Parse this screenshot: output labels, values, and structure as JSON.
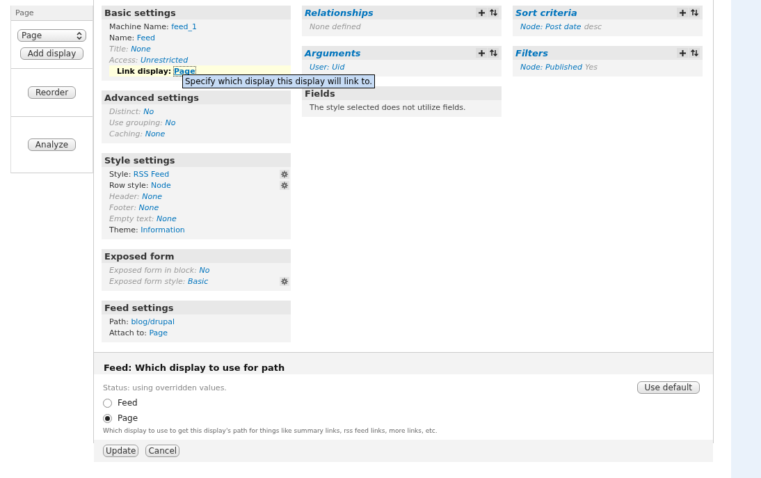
{
  "sidebar": {
    "tab_label": "Page",
    "select_value": "Page",
    "buttons": [
      "Add display",
      "Reorder",
      "Analyze"
    ]
  },
  "settings_sections": [
    {
      "title": "Basic settings",
      "items": [
        {
          "label": "Machine Name:",
          "value": "feed_1",
          "kind": "override",
          "has_settings": false
        },
        {
          "label": "Name:",
          "value": "Feed",
          "kind": "override",
          "has_settings": false
        },
        {
          "label": "Title:",
          "value": "None",
          "kind": "default",
          "has_settings": false
        },
        {
          "label": "Access:",
          "value": "Unrestricted",
          "kind": "default",
          "has_settings": false
        },
        {
          "label": "Link display:",
          "value": "Page",
          "kind": "highlight",
          "has_settings": false
        }
      ]
    },
    {
      "title": "Advanced settings",
      "items": [
        {
          "label": "Distinct:",
          "value": "No",
          "kind": "default",
          "has_settings": false
        },
        {
          "label": "Use grouping:",
          "value": "No",
          "kind": "default",
          "has_settings": false
        },
        {
          "label": "Caching:",
          "value": "None",
          "kind": "default",
          "has_settings": false
        }
      ]
    },
    {
      "title": "Style settings",
      "items": [
        {
          "label": "Style:",
          "value": "RSS Feed",
          "kind": "override",
          "has_settings": true
        },
        {
          "label": "Row style:",
          "value": "Node",
          "kind": "override",
          "has_settings": true
        },
        {
          "label": "Header:",
          "value": "None",
          "kind": "default",
          "has_settings": false
        },
        {
          "label": "Footer:",
          "value": "None",
          "kind": "default",
          "has_settings": false
        },
        {
          "label": "Empty text:",
          "value": "None",
          "kind": "default",
          "has_settings": false
        },
        {
          "label": "Theme:",
          "value": "Information",
          "kind": "override",
          "has_settings": false
        }
      ]
    },
    {
      "title": "Exposed form",
      "items": [
        {
          "label": "Exposed form in block:",
          "value": "No",
          "kind": "default",
          "has_settings": false
        },
        {
          "label": "Exposed form style:",
          "value": "Basic",
          "kind": "default",
          "has_settings": true
        }
      ]
    },
    {
      "title": "Feed settings",
      "items": [
        {
          "label": "Path:",
          "value": "blog/drupal",
          "kind": "override",
          "has_settings": false
        },
        {
          "label": "Attach to:",
          "value": "Page",
          "kind": "override",
          "has_settings": false
        }
      ]
    }
  ],
  "tooltip": "Specify which display this display will link to.",
  "middle_sections": [
    {
      "title": "Relationships",
      "linked": true,
      "has_actions": true,
      "items": [
        {
          "text": "None defined",
          "kind": "empty"
        }
      ]
    },
    {
      "title": "Arguments",
      "linked": true,
      "has_actions": true,
      "items": [
        {
          "text": "User: Uid",
          "kind": "link"
        }
      ]
    },
    {
      "title": "Fields",
      "linked": false,
      "has_actions": false,
      "items": [
        {
          "text": "The style selected does not utilize fields.",
          "kind": "note"
        }
      ]
    }
  ],
  "right_sections": [
    {
      "title": "Sort criteria",
      "linked": true,
      "has_actions": true,
      "items": [
        {
          "text": "Node: Post date",
          "suffix": "desc",
          "kind": "link"
        }
      ]
    },
    {
      "title": "Filters",
      "linked": true,
      "has_actions": true,
      "items": [
        {
          "text": "Node: Published",
          "suffix": "Yes",
          "kind": "link"
        }
      ]
    }
  ],
  "form": {
    "title": "Feed: Which display to use for path",
    "status": "Status: using overridden values.",
    "reset_button": "Use default",
    "options": [
      {
        "label": "Feed",
        "selected": false
      },
      {
        "label": "Page",
        "selected": true
      }
    ],
    "description": "Which display to use to get this display's path for things like summary links, rss feed links, more links, etc.",
    "buttons": [
      "Update",
      "Cancel"
    ]
  }
}
